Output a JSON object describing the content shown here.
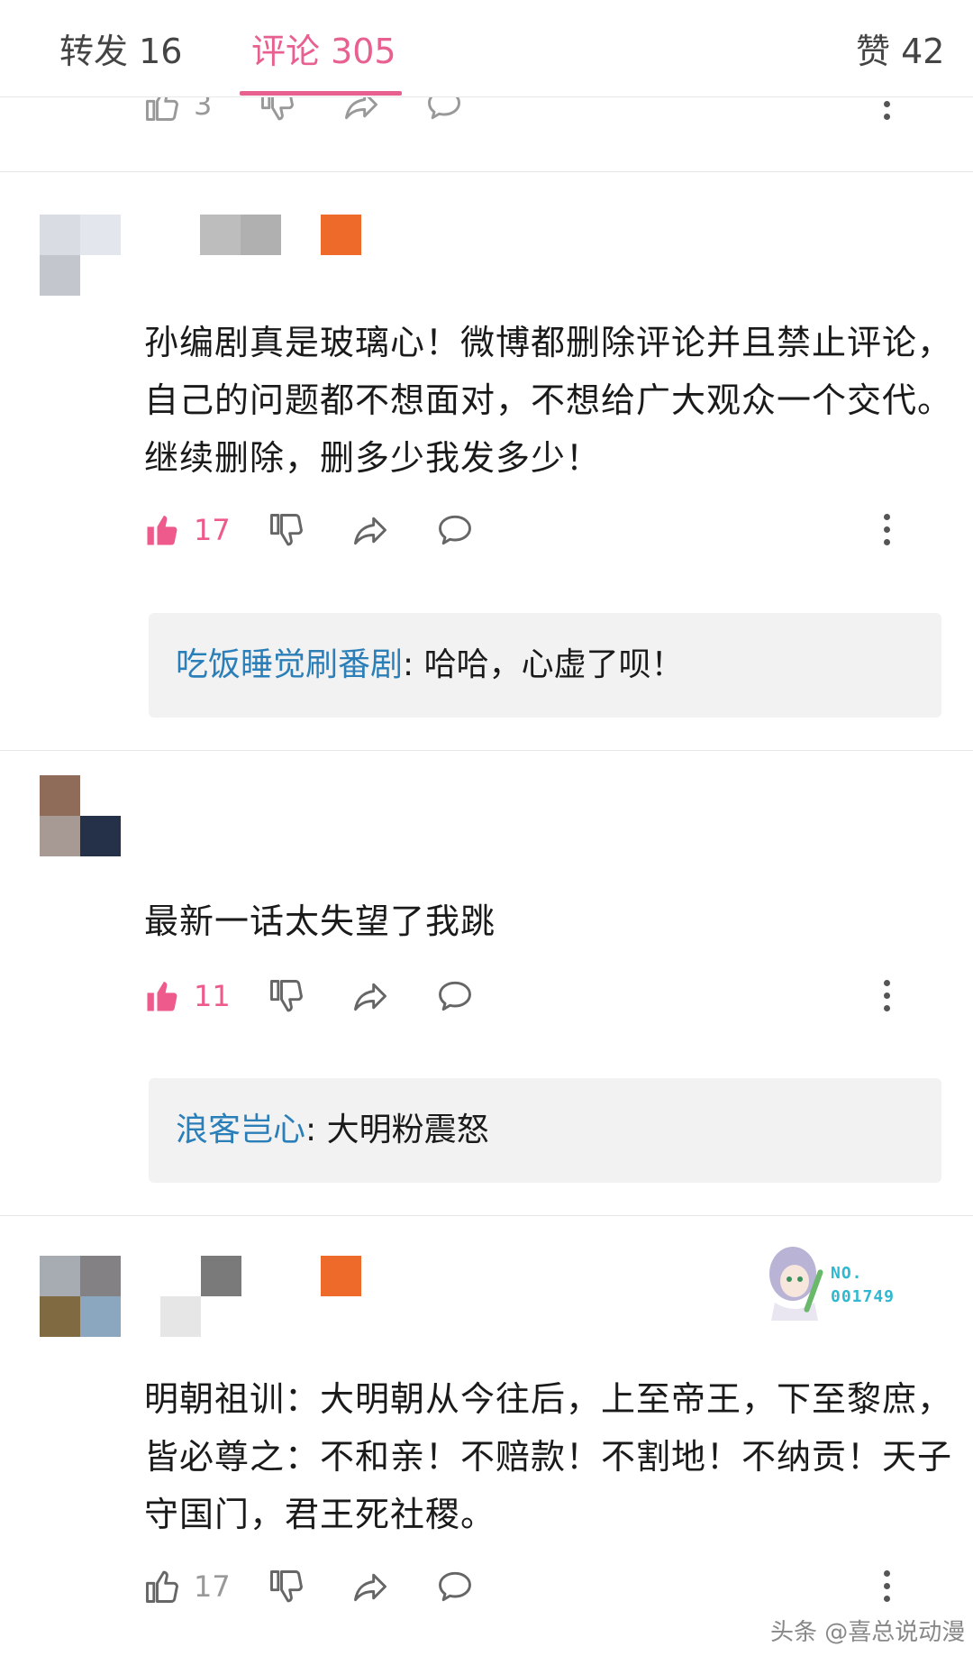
{
  "tabs": {
    "repost": "转发 16",
    "comments": "评论 305",
    "likes": "赞 42"
  },
  "partial_row": {
    "like_count": "3"
  },
  "comments": [
    {
      "text": "孙编剧真是玻璃心！微博都删除评论并且禁止评论，自己的问题都不想面对，不想给广大观众一个交代。继续删除，删多少我发多少！",
      "likes": "17",
      "liked": true,
      "reply": {
        "name": "吃饭睡觉刷番剧",
        "sep": ": ",
        "text": "哈哈，心虚了呗！"
      }
    },
    {
      "text": "最新一话太失望了我跳",
      "likes": "11",
      "liked": true,
      "reply": {
        "name": "浪客岂心",
        "sep": ": ",
        "text": "大明粉震怒"
      }
    },
    {
      "text": "明朝祖训：大明朝从今往后，上至帝王，下至黎庶，皆必尊之：不和亲！不赔款！不割地！不纳贡！天子守国门，君王死社稷。",
      "likes": "17",
      "liked": false,
      "badge": {
        "line1": "NO.",
        "line2": "001749"
      }
    }
  ],
  "watermark": "头条 @喜总说动漫",
  "colors": {
    "accent": "#e7608f",
    "reply_name": "#2b7fb8",
    "vip": "#ee6a2a"
  }
}
